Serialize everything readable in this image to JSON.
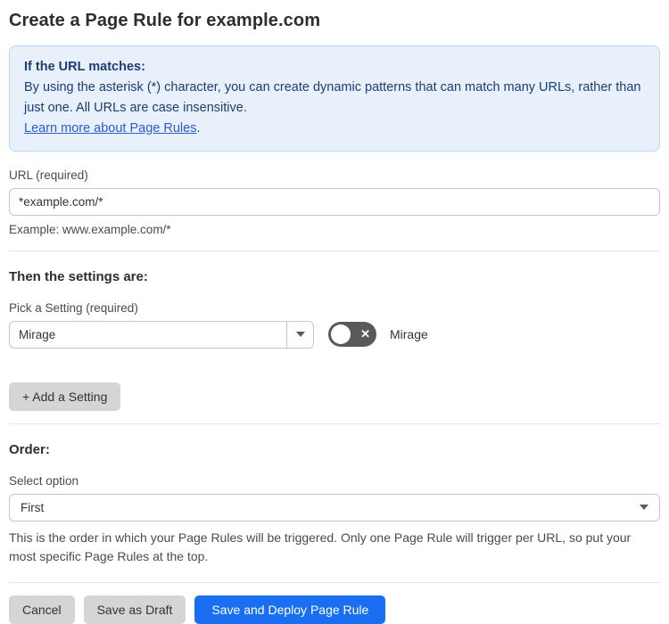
{
  "page": {
    "title": "Create a Page Rule for example.com"
  },
  "info_box": {
    "heading": "If the URL matches:",
    "body": "By using the asterisk (*) character, you can create dynamic patterns that can match many URLs, rather than just one. All URLs are case insensitive.",
    "link": "Learn more about Page Rules",
    "link_suffix": "."
  },
  "url_field": {
    "label": "URL (required)",
    "value": "*example.com/*",
    "hint": "Example: www.example.com/*"
  },
  "settings_section": {
    "heading": "Then the settings are:",
    "picker_label": "Pick a Setting (required)",
    "picker_value": "Mirage",
    "toggle_label": "Mirage",
    "toggle_state": "off",
    "toggle_x_glyph": "✕",
    "add_setting_button": "+ Add a Setting"
  },
  "order_section": {
    "heading": "Order:",
    "select_label": "Select option",
    "select_value": "First",
    "help": "This is the order in which your Page Rules will be triggered. Only one Page Rule will trigger per URL, so put your most specific Page Rules at the top."
  },
  "actions": {
    "cancel": "Cancel",
    "save_draft": "Save as Draft",
    "save_deploy": "Save and Deploy Page Rule"
  },
  "colors": {
    "primary_blue": "#1a6ef2",
    "info_background": "#e8f1fb",
    "info_border": "#bad6f1",
    "info_text": "#1e3c74",
    "link_blue": "#2a5ad4",
    "toggle_off_gray": "#595959",
    "button_gray": "#d5d5d5"
  }
}
